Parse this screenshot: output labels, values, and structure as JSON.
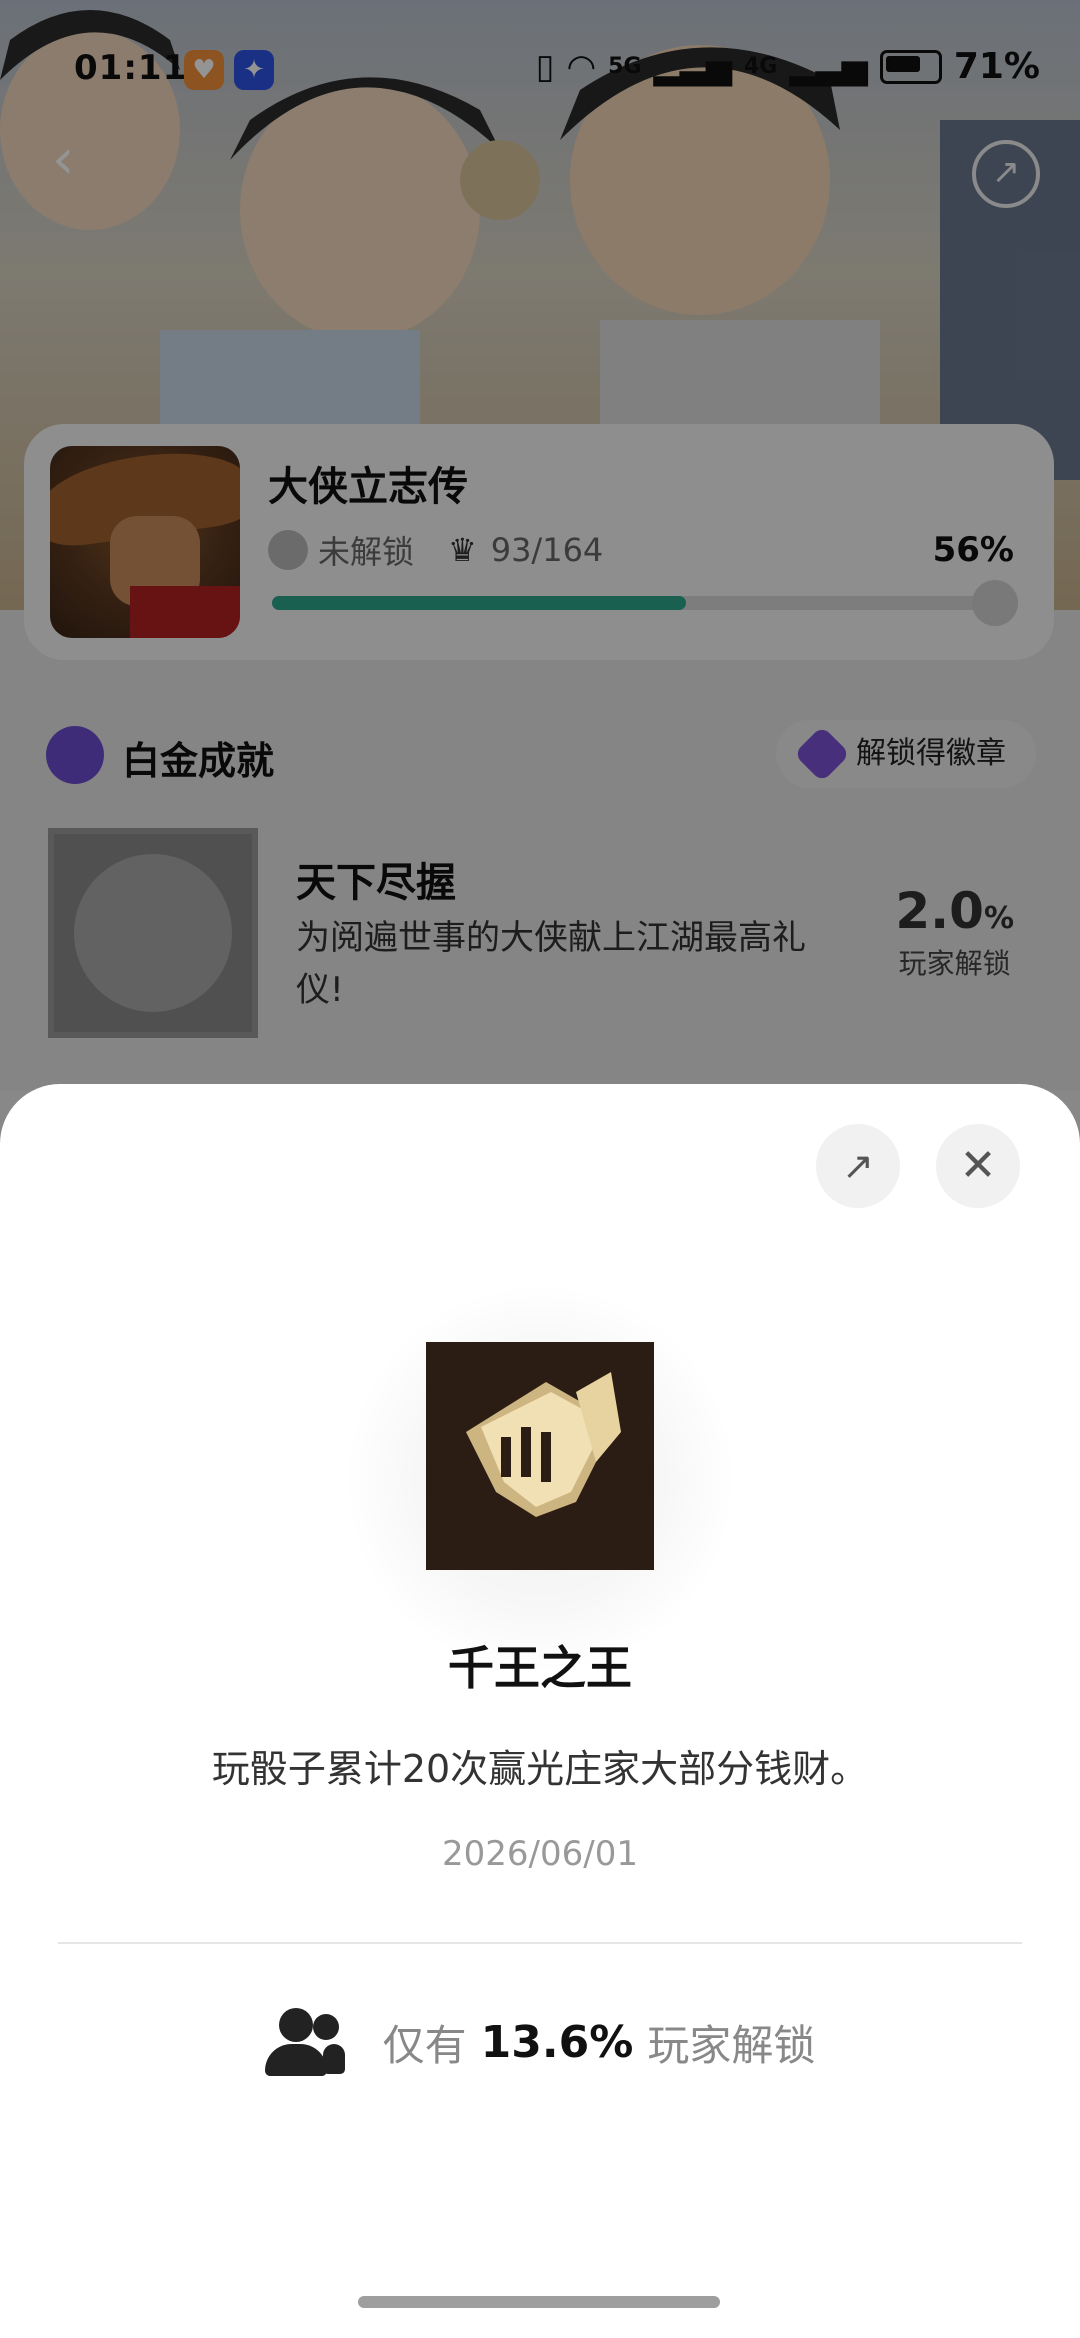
{
  "status_bar": {
    "time": "01:11",
    "network_5g": "5G",
    "network_4g": "4G",
    "battery": "71%"
  },
  "nav": {
    "back_glyph": "‹",
    "share_glyph": "↗"
  },
  "game": {
    "title": "大侠立志传",
    "lock_status": "未解锁",
    "achievements_count": "93/164",
    "progress_pct": "56%",
    "progress_value": 0.56
  },
  "platinum": {
    "section_title": "白金成就",
    "badge_button": "解锁得徽章",
    "achievement": {
      "title": "天下尽握",
      "description": "为阅遍世事的大侠献上江湖最高礼仪!",
      "rate_value": "2.0",
      "rate_unit": "%",
      "rate_label": "玩家解锁"
    }
  },
  "sheet": {
    "share_glyph": "↗",
    "close_glyph": "✕",
    "achievement_title": "千王之王",
    "description": "玩骰子累计20次赢光庄家大部分钱财。",
    "date": "2026/06/01",
    "stat_prefix": "仅有",
    "stat_value": "13.6%",
    "stat_suffix": "玩家解锁"
  },
  "colors": {
    "progress_fill": "#2ba58a",
    "platinum_purple": "#6b4cd1",
    "icon_bg": "#2b1c14"
  }
}
